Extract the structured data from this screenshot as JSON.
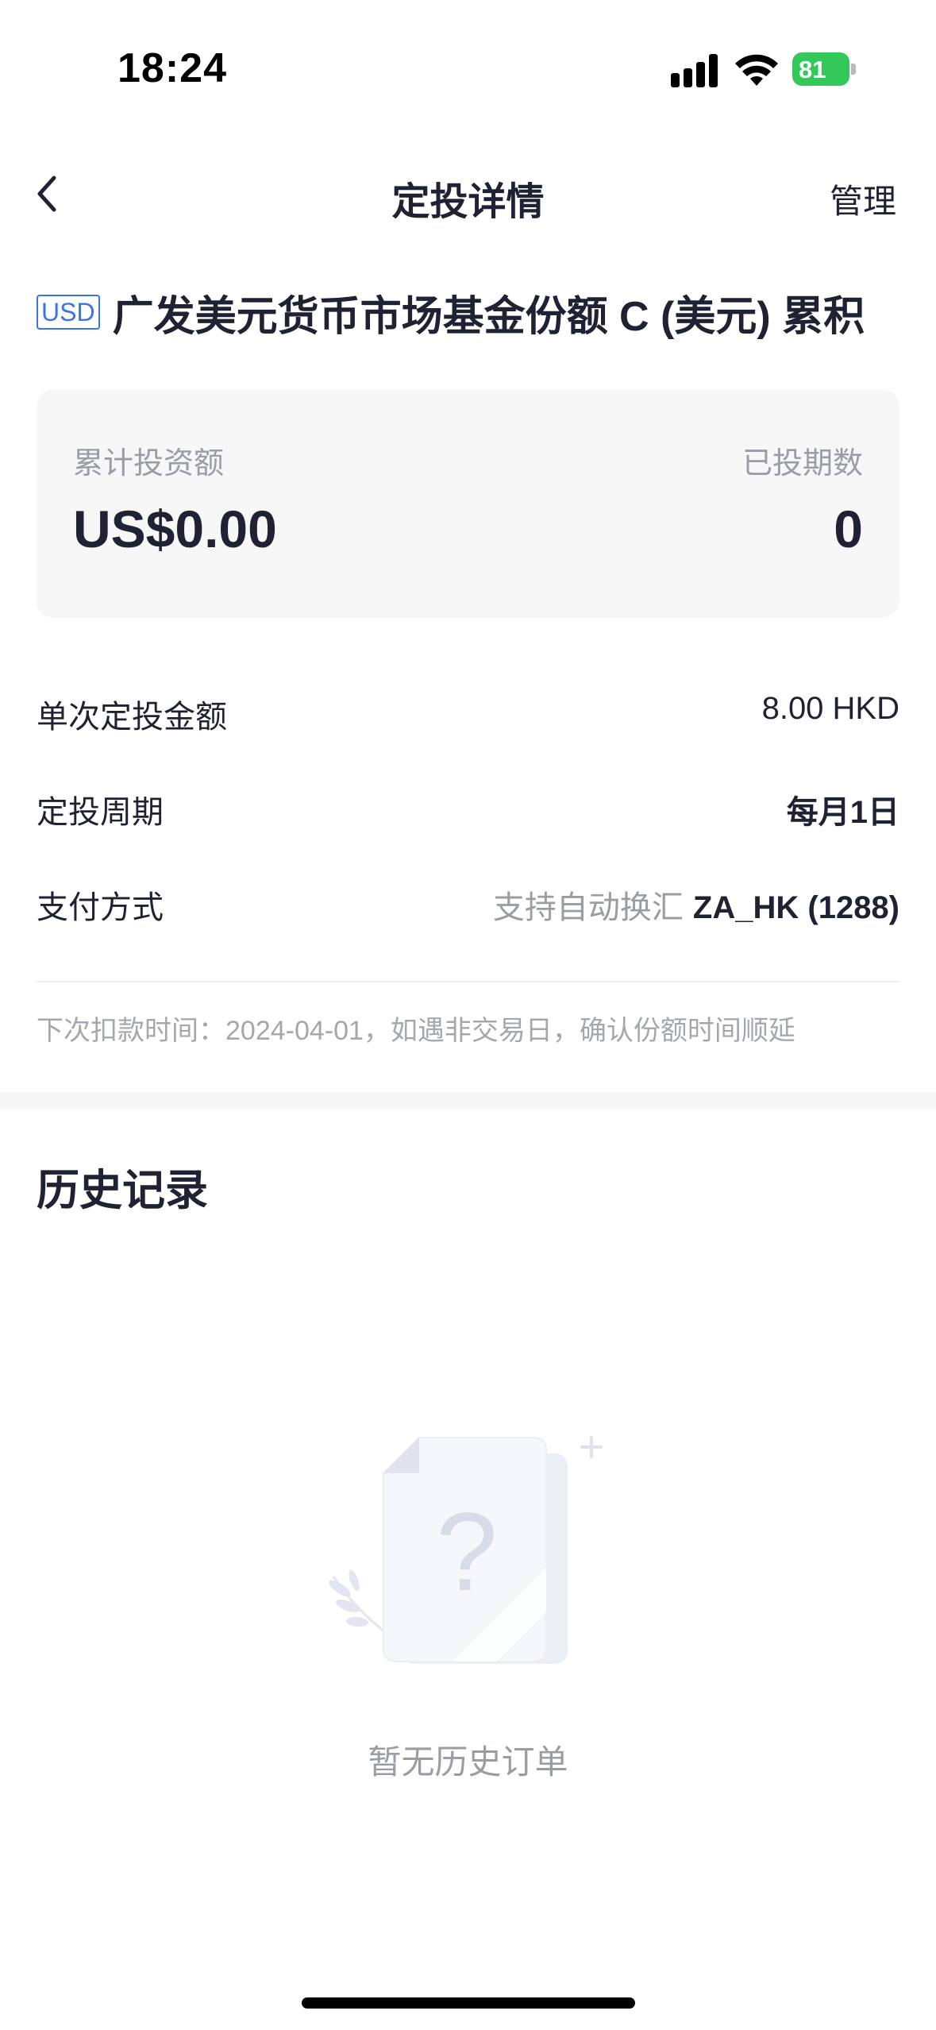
{
  "status_bar": {
    "time": "18:24",
    "battery": "81"
  },
  "nav": {
    "title": "定投详情",
    "manage_label": "管理"
  },
  "fund": {
    "currency": "USD",
    "name": "广发美元货币市场基金份额 C (美元) 累积"
  },
  "summary": {
    "total_invested_label": "累计投资额",
    "total_invested_value": "US$0.00",
    "periods_label": "已投期数",
    "periods_value": "0"
  },
  "details": [
    {
      "label": "单次定投金额",
      "value": "8.00 HKD"
    },
    {
      "label": "定投周期",
      "value": "每月1日"
    },
    {
      "label": "支付方式",
      "value_muted": "支持自动换汇",
      "value": "ZA_HK (1288)"
    }
  ],
  "next_note": "下次扣款时间：2024-04-01，如遇非交易日，确认份额时间顺延",
  "history": {
    "title": "历史记录",
    "empty_text": "暂无历史订单"
  },
  "colors": {
    "accent_blue": "#3b74e3",
    "battery_green": "#34c759",
    "muted_text": "#9a9ca6",
    "card_bg": "#f7f7f8"
  }
}
